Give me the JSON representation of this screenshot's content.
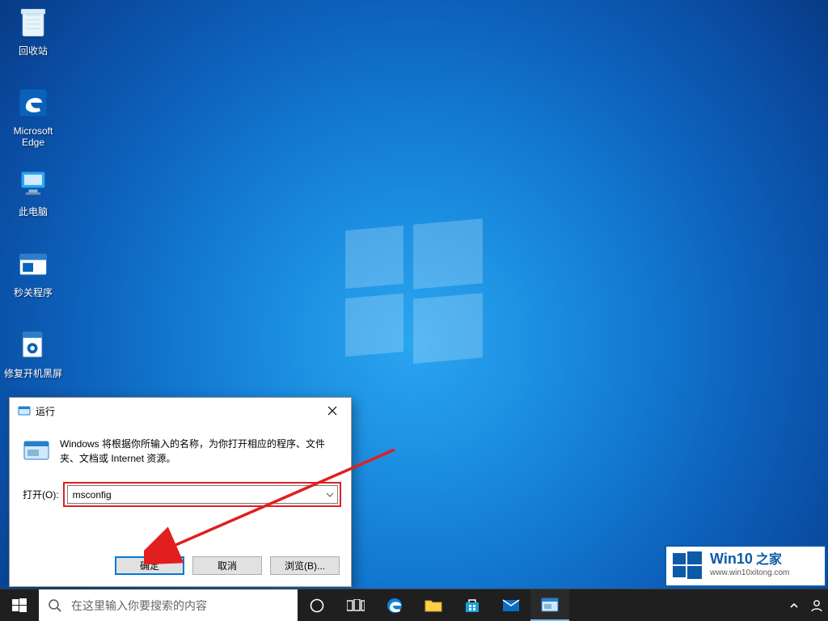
{
  "desktop_icons": [
    {
      "name": "recycle-bin",
      "label": "回收站"
    },
    {
      "name": "edge",
      "label": "Microsoft\nEdge"
    },
    {
      "name": "this-pc",
      "label": "此电脑"
    },
    {
      "name": "shutdown-app",
      "label": "秒关程序"
    },
    {
      "name": "fix-boot-black",
      "label": "修复开机黑屏"
    }
  ],
  "run_dialog": {
    "title": "运行",
    "description": "Windows 将根据你所输入的名称，为你打开相应的程序、文件夹、文档或 Internet 资源。",
    "open_label": "打开(O):",
    "value": "msconfig",
    "ok": "确定",
    "cancel": "取消",
    "browse": "浏览(B)..."
  },
  "taskbar": {
    "search_placeholder": "在这里输入你要搜索的内容"
  },
  "watermark": {
    "brand": "Win10",
    "suffix": "之家",
    "url": "www.win10xitong.com"
  }
}
